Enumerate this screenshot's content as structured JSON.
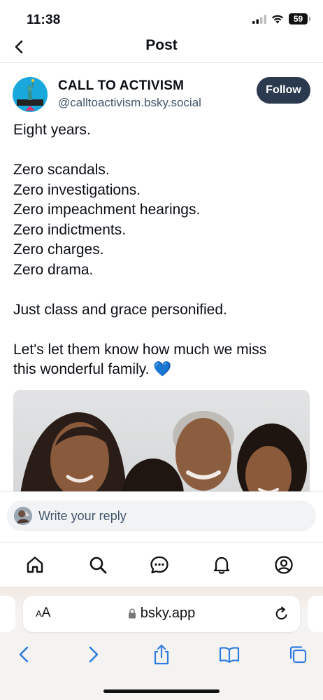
{
  "status_bar": {
    "time": "11:38",
    "battery": "59"
  },
  "header": {
    "title": "Post"
  },
  "post": {
    "author": {
      "display_name": "CALL TO ACTIVISM",
      "handle": "@calltoactivism.bsky.social"
    },
    "follow_label": "Follow",
    "lines": [
      "Eight years.",
      "",
      "Zero scandals.",
      "Zero investigations.",
      "Zero impeachment hearings.",
      "Zero indictments.",
      "Zero charges.",
      "Zero drama.",
      "",
      "Just class and grace personified.",
      "",
      "Let's let them know how much we miss",
      "this wonderful family. 💙"
    ]
  },
  "reply": {
    "placeholder": "Write your reply"
  },
  "tabs": [
    "home-icon",
    "search-icon",
    "chat-icon",
    "bell-icon",
    "profile-icon"
  ],
  "browser": {
    "aa_label_small": "A",
    "aa_label_large": "A",
    "url": "bsky.app"
  },
  "toolbar_icons": [
    "back-arrow-icon",
    "forward-arrow-icon",
    "share-icon",
    "bookmarks-icon",
    "tabs-icon"
  ],
  "colors": {
    "follow_bg": "#2b3a4e",
    "safari_blue": "#2f7de1",
    "handle_gray": "#42576c"
  }
}
